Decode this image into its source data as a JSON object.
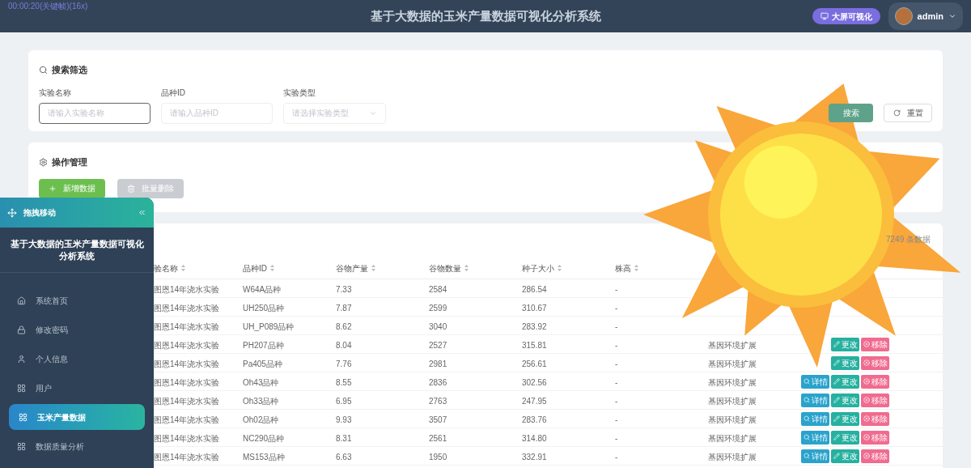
{
  "recorder_text": "00:00:20(关键帧)(16x)",
  "header": {
    "title": "基于大数据的玉米产量数据可视化分析系统",
    "screen_button": "大屏可视化",
    "user": "admin"
  },
  "search_panel": {
    "title": "搜索筛选",
    "fields": [
      {
        "label": "实验名称",
        "placeholder": "请输入实验名称",
        "kind": "input",
        "focused": true
      },
      {
        "label": "品种ID",
        "placeholder": "请输入品种ID",
        "kind": "input",
        "focused": false
      },
      {
        "label": "实验类型",
        "placeholder": "请选择实验类型",
        "kind": "select",
        "focused": false
      }
    ],
    "search_button": "搜索",
    "reset_button": "重置"
  },
  "operations": {
    "title": "操作管理",
    "buttons": [
      {
        "label": "新增数据",
        "kind": "add"
      },
      {
        "label": "批量删除",
        "kind": "delete-disabled"
      }
    ]
  },
  "table": {
    "total": "7249 条数据",
    "columns": [
      "验名称",
      "品种ID",
      "谷物产量",
      "谷物数量",
      "种子大小",
      "株高"
    ],
    "rows": [
      {
        "cells": [
          "图恩14年浇水实验",
          "W64A品种",
          "7.33",
          "2584",
          "286.54",
          "-"
        ]
      },
      {
        "cells": [
          "图恩14年浇水实验",
          "UH250品种",
          "7.87",
          "2599",
          "310.67",
          "-"
        ]
      },
      {
        "cells": [
          "图恩14年浇水实验",
          "UH_P089品种",
          "8.62",
          "3040",
          "283.92",
          "-"
        ]
      },
      {
        "cells": [
          "图恩14年浇水实验",
          "PH207品种",
          "8.04",
          "2527",
          "315.81",
          "-"
        ],
        "column_7": "基因环境扩展",
        "actions": [
          {
            "label": "更改",
            "kind": "edit"
          },
          {
            "label": "移除",
            "kind": "remove"
          }
        ]
      },
      {
        "cells": [
          "图恩14年浇水实验",
          "Pa405品种",
          "7.76",
          "2981",
          "256.61",
          "-"
        ],
        "column_7": "基因环境扩展",
        "actions": [
          {
            "label": "更改",
            "kind": "edit"
          },
          {
            "label": "移除",
            "kind": "remove"
          }
        ]
      },
      {
        "cells": [
          "图恩14年浇水实验",
          "Oh43品种",
          "8.55",
          "2836",
          "302.56",
          "-"
        ],
        "column_7": "基因环境扩展",
        "actions": [
          {
            "label": "详情",
            "kind": "detail"
          },
          {
            "label": "更改",
            "kind": "edit"
          },
          {
            "label": "移除",
            "kind": "remove"
          }
        ]
      },
      {
        "cells": [
          "图恩14年浇水实验",
          "Oh33品种",
          "6.95",
          "2763",
          "247.95",
          "-"
        ],
        "column_7": "基因环境扩展",
        "actions": [
          {
            "label": "详情",
            "kind": "detail"
          },
          {
            "label": "更改",
            "kind": "edit"
          },
          {
            "label": "移除",
            "kind": "remove"
          }
        ]
      },
      {
        "cells": [
          "图恩14年浇水实验",
          "Oh02品种",
          "9.93",
          "3507",
          "283.76",
          "-"
        ],
        "column_7": "基因环境扩展",
        "actions": [
          {
            "label": "详情",
            "kind": "detail"
          },
          {
            "label": "更改",
            "kind": "edit"
          },
          {
            "label": "移除",
            "kind": "remove"
          }
        ]
      },
      {
        "cells": [
          "图恩14年浇水实验",
          "NC290品种",
          "8.31",
          "2561",
          "314.80",
          "-"
        ],
        "column_7": "基因环境扩展",
        "actions": [
          {
            "label": "详情",
            "kind": "detail"
          },
          {
            "label": "更改",
            "kind": "edit"
          },
          {
            "label": "移除",
            "kind": "remove"
          }
        ]
      },
      {
        "cells": [
          "图恩14年浇水实验",
          "MS153品种",
          "6.63",
          "1950",
          "332.91",
          "-"
        ],
        "column_7": "基因环境扩展",
        "actions": [
          {
            "label": "详情",
            "kind": "detail"
          },
          {
            "label": "更改",
            "kind": "edit"
          },
          {
            "label": "移除",
            "kind": "remove"
          }
        ]
      }
    ]
  },
  "sidebar": {
    "drag_label": "拖拽移动",
    "title": "基于大数据的玉米产量数据可视化分析系统",
    "items": [
      {
        "label": "系统首页",
        "selected": false
      },
      {
        "label": "修改密码",
        "selected": false
      },
      {
        "label": "个人信息",
        "selected": false
      },
      {
        "label": "用户",
        "selected": false
      },
      {
        "label": "玉米产量数据",
        "selected": true
      },
      {
        "label": "数据质量分析",
        "selected": false
      }
    ]
  }
}
